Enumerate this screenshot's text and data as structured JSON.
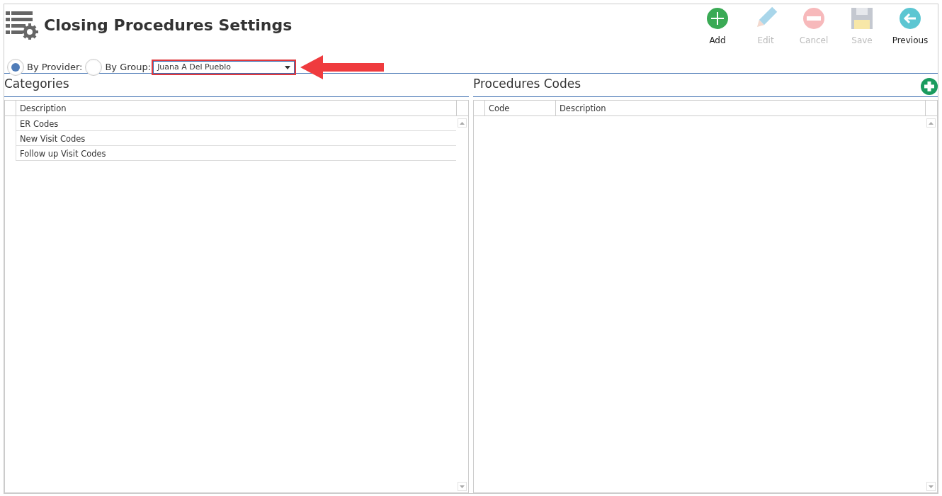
{
  "title": "Closing Procedures Settings",
  "toolbar": [
    {
      "label": "Add",
      "kind": "add",
      "disabled": false
    },
    {
      "label": "Edit",
      "kind": "edit",
      "disabled": true
    },
    {
      "label": "Cancel",
      "kind": "cancel",
      "disabled": true
    },
    {
      "label": "Save",
      "kind": "save",
      "disabled": true
    },
    {
      "label": "Previous",
      "kind": "previous",
      "disabled": false
    }
  ],
  "filter": {
    "options": [
      {
        "label": "By Provider:",
        "selected": true
      },
      {
        "label": "By Group:",
        "selected": false
      }
    ],
    "dropdown": {
      "value": "Juana A Del Pueblo"
    }
  },
  "categories": {
    "title": "Categories",
    "columns": [
      "Description"
    ],
    "rows": [
      {
        "description": "ER Codes"
      },
      {
        "description": "New Visit Codes"
      },
      {
        "description": "Follow up Visit Codes"
      }
    ]
  },
  "procedures": {
    "title": "Procedures Codes",
    "columns": [
      "Code",
      "Description"
    ]
  }
}
